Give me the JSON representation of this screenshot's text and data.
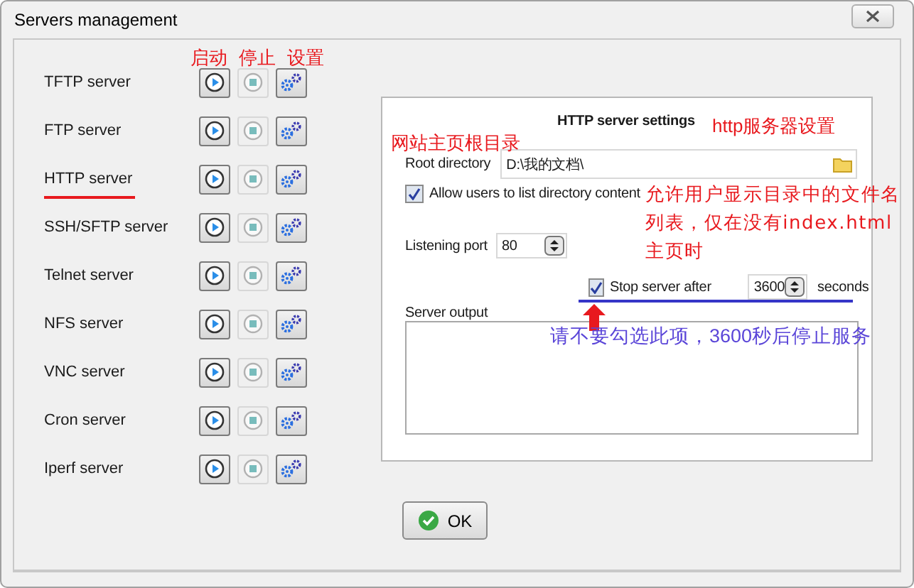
{
  "window": {
    "title": "Servers management"
  },
  "servers": [
    {
      "name": "TFTP server",
      "underlined": false,
      "stop_disabled": true
    },
    {
      "name": "FTP server",
      "underlined": false,
      "stop_disabled": true
    },
    {
      "name": "HTTP server",
      "underlined": true,
      "stop_disabled": true
    },
    {
      "name": "SSH/SFTP server",
      "underlined": false,
      "stop_disabled": true
    },
    {
      "name": "Telnet server",
      "underlined": false,
      "stop_disabled": true
    },
    {
      "name": "NFS server",
      "underlined": false,
      "stop_disabled": true
    },
    {
      "name": "VNC server",
      "underlined": false,
      "stop_disabled": true
    },
    {
      "name": "Cron server",
      "underlined": false,
      "stop_disabled": true
    },
    {
      "name": "Iperf server",
      "underlined": false,
      "stop_disabled": true
    }
  ],
  "settings": {
    "title": "HTTP server settings",
    "root_directory": {
      "label": "Root directory",
      "value": "D:\\我的文档\\"
    },
    "list_directory": {
      "label": "Allow users to list directory content",
      "checked": true
    },
    "listening_port": {
      "label": "Listening port",
      "value": "80"
    },
    "stop_after": {
      "label": "Stop server after",
      "checked": true,
      "value": "3600",
      "unit": "seconds"
    },
    "output": {
      "label": "Server output"
    }
  },
  "ok_button": {
    "label": "OK"
  },
  "annotations": {
    "column_labels": [
      "启动",
      "停止",
      "设置"
    ],
    "root_note": "网站主页根目录",
    "settings_note": "http服务器设置",
    "list_note": "允许用户显示目录中的文件名列表，仅在没有index.html主页时",
    "stop_note": "请不要勾选此项，3600秒后停止服务"
  }
}
